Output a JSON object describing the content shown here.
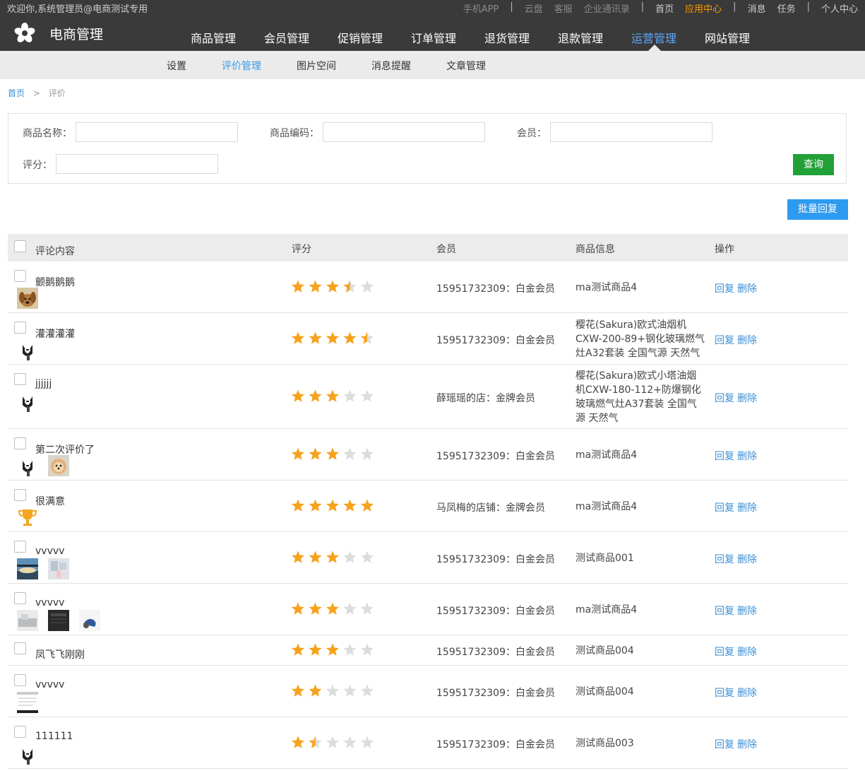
{
  "topbar": {
    "welcome": "欢迎你,系统管理员@电商测试专用",
    "links": [
      {
        "label": "手机APP",
        "style": "dim"
      },
      {
        "sep": "|"
      },
      {
        "label": "云盘",
        "style": "dim"
      },
      {
        "label": "客服",
        "style": "dim"
      },
      {
        "label": "企业通讯录",
        "style": "dim"
      },
      {
        "sep": "|"
      },
      {
        "label": "首页",
        "style": "white"
      },
      {
        "label": "应用中心",
        "style": "orange"
      },
      {
        "sep": "|"
      },
      {
        "label": "消息",
        "style": "white"
      },
      {
        "label": "任务",
        "style": "white"
      },
      {
        "sep": "|"
      },
      {
        "label": "个人中心",
        "style": "white"
      }
    ]
  },
  "brand": {
    "title": "电商管理"
  },
  "nav": {
    "items": [
      "商品管理",
      "会员管理",
      "促销管理",
      "订单管理",
      "退货管理",
      "退款管理",
      "运营管理",
      "网站管理"
    ],
    "active_index": 6
  },
  "subnav": {
    "items": [
      "设置",
      "评价管理",
      "图片空间",
      "消息提醒",
      "文章管理"
    ],
    "active_index": 1
  },
  "breadcrumb": {
    "home": "首页",
    "sep": ">",
    "current": "评价"
  },
  "search": {
    "product_name_label": "商品名称：",
    "product_code_label": "商品编码：",
    "member_label": "会员：",
    "score_label": "评分：",
    "product_name_value": "",
    "product_code_value": "",
    "member_value": "",
    "score_value": "",
    "query_button": "查询"
  },
  "batch_reply_button": "批量回复",
  "table": {
    "headers": {
      "comment": "评论内容",
      "score": "评分",
      "member": "会员",
      "product": "商品信息",
      "ops": "操作"
    },
    "reply_label": "回复",
    "delete_label": "删除",
    "rows": [
      {
        "comment": "颤鹅鹅鹅",
        "rating": 3.5,
        "member": "15951732309：白金会员",
        "product": "ma测试商品4",
        "thumbs": [
          "dog"
        ]
      },
      {
        "comment": "灌灌灌灌",
        "rating": 4.5,
        "member": "15951732309：白金会员",
        "product": "樱花(Sakura)欧式油烟机CXW-200-89+钢化玻璃燃气灶A32套装 全国气源 天然气",
        "thumbs": [
          "husky"
        ]
      },
      {
        "comment": "jjjjjj",
        "rating": 3,
        "member": "薛瑶瑶的店：金牌会员",
        "product": "樱花(Sakura)欧式小塔油烟机CXW-180-112+防爆钢化玻璃燃气灶A37套装 全国气源 天然气",
        "thumbs": [
          "husky"
        ]
      },
      {
        "comment": "第二次评价了",
        "rating": 3,
        "member": "15951732309：白金会员",
        "product": "ma测试商品4",
        "thumbs": [
          "husky",
          "pomeranian"
        ]
      },
      {
        "comment": "很满意",
        "rating": 5,
        "member": "马凤梅的店铺：金牌会员",
        "product": "ma测试商品4",
        "thumbs": [
          "trophy"
        ]
      },
      {
        "comment": "vvvvv",
        "rating": 3,
        "member": "15951732309：白金会员",
        "product": "测试商品001",
        "thumbs": [
          "landscape",
          "room"
        ]
      },
      {
        "comment": "vvvvv",
        "rating": 3,
        "member": "15951732309：白金会员",
        "product": "ma测试商品4",
        "thumbs": [
          "photo",
          "dark",
          "figure"
        ]
      },
      {
        "comment": "凤飞飞刚刚",
        "rating": 3,
        "member": "15951732309：白金会员",
        "product": "测试商品004",
        "thumbs": []
      },
      {
        "comment": "vvvvv",
        "rating": 2,
        "member": "15951732309：白金会员",
        "product": "测试商品004",
        "thumbs": [
          "screenshot"
        ]
      },
      {
        "comment": "111111",
        "rating": 1.5,
        "member": "15951732309：白金会员",
        "product": "测试商品003",
        "thumbs": [
          "husky"
        ]
      }
    ]
  },
  "colors": {
    "star": "#f7a21b",
    "star_empty": "#dcdcdc",
    "accent": "#5aa8ff",
    "link": "#3a8fd6",
    "query": "#22a038",
    "batch": "#2e9bf0"
  }
}
